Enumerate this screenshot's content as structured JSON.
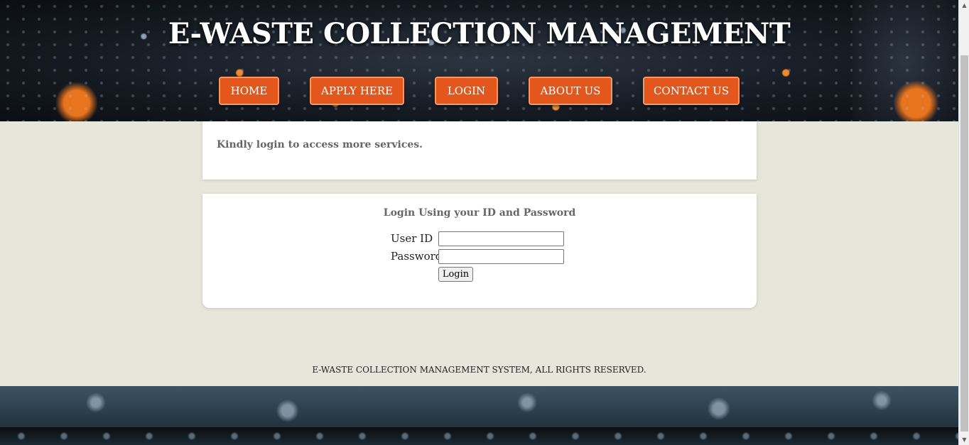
{
  "header": {
    "title": "E-WASTE COLLECTION MANAGEMENT"
  },
  "nav": {
    "items": [
      {
        "label": "HOME"
      },
      {
        "label": "APPLY HERE"
      },
      {
        "label": "LOGIN"
      },
      {
        "label": "ABOUT US"
      },
      {
        "label": "CONTACT US"
      }
    ]
  },
  "info": {
    "message": "Kindly login to access more services."
  },
  "login": {
    "heading": "Login Using your ID and Password",
    "user_id_label": "User ID",
    "user_id_value": "",
    "password_label": "Password",
    "password_value": "",
    "submit_label": "Login"
  },
  "footer": {
    "text": "E-WASTE COLLECTION MANAGEMENT SYSTEM, ALL RIGHTS RESERVED."
  },
  "icons": {
    "scroll_up": "scroll-up-icon",
    "scroll_down": "scroll-down-icon"
  },
  "colors": {
    "nav_button": "#e4571c",
    "page_background": "#e6e6da",
    "card": "#ffffff"
  }
}
